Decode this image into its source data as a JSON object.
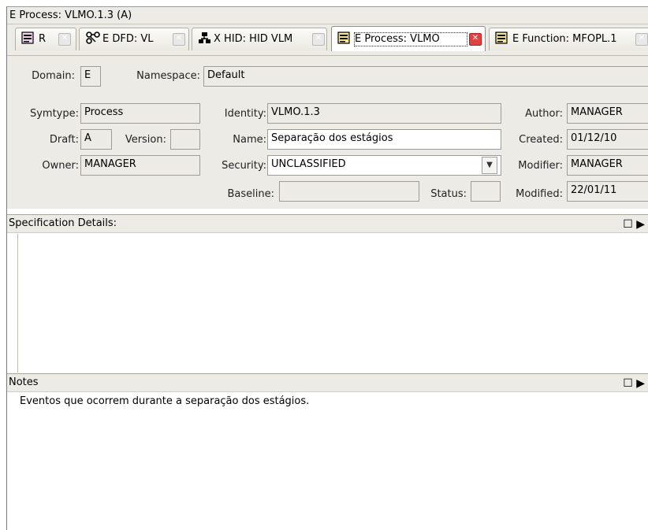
{
  "window": {
    "title": "E Process: VLMO.1.3 (A)"
  },
  "tabs": [
    {
      "icon": "document-icon",
      "label": "R",
      "active": false
    },
    {
      "icon": "dfd-diagram-icon",
      "label": "E DFD: VL",
      "active": false
    },
    {
      "icon": "hierarchy-diagram-icon",
      "label": "X HID: HID VLM",
      "active": false
    },
    {
      "icon": "document-icon",
      "label": "E Process: VLMO",
      "active": true
    },
    {
      "icon": "document-icon",
      "label": "E Function: MFOPL.1",
      "active": false
    }
  ],
  "form": {
    "domain_label": "Domain:",
    "domain_value": "E",
    "namespace_label": "Namespace:",
    "namespace_value": "Default",
    "symtype_label": "Symtype:",
    "symtype_value": "Process",
    "identity_label": "Identity:",
    "identity_value": "VLMO.1.3",
    "author_label": "Author:",
    "author_value": "MANAGER",
    "draft_label": "Draft:",
    "draft_value": "A",
    "version_label": "Version:",
    "version_value": "",
    "name_label": "Name:",
    "name_value": "Separação dos estágios",
    "created_label": "Created:",
    "created_value": "01/12/10",
    "owner_label": "Owner:",
    "owner_value": "MANAGER",
    "security_label": "Security:",
    "security_value": "UNCLASSIFIED",
    "modifier_label": "Modifier:",
    "modifier_value": "MANAGER",
    "baseline_label": "Baseline:",
    "baseline_value": "",
    "status_label": "Status:",
    "status_value": "",
    "modified_label": "Modified:",
    "modified_value": "22/01/11"
  },
  "spec_details": {
    "title": "Specification Details:",
    "text": ""
  },
  "notes": {
    "title": "Notes",
    "text": "Eventos que ocorrem durante a separação dos estágios."
  },
  "colors": {
    "panel": "#ecebe6",
    "close_active": "#e04141",
    "icon_doc": "#d946c8",
    "icon_yellow": "#f2c21b"
  }
}
